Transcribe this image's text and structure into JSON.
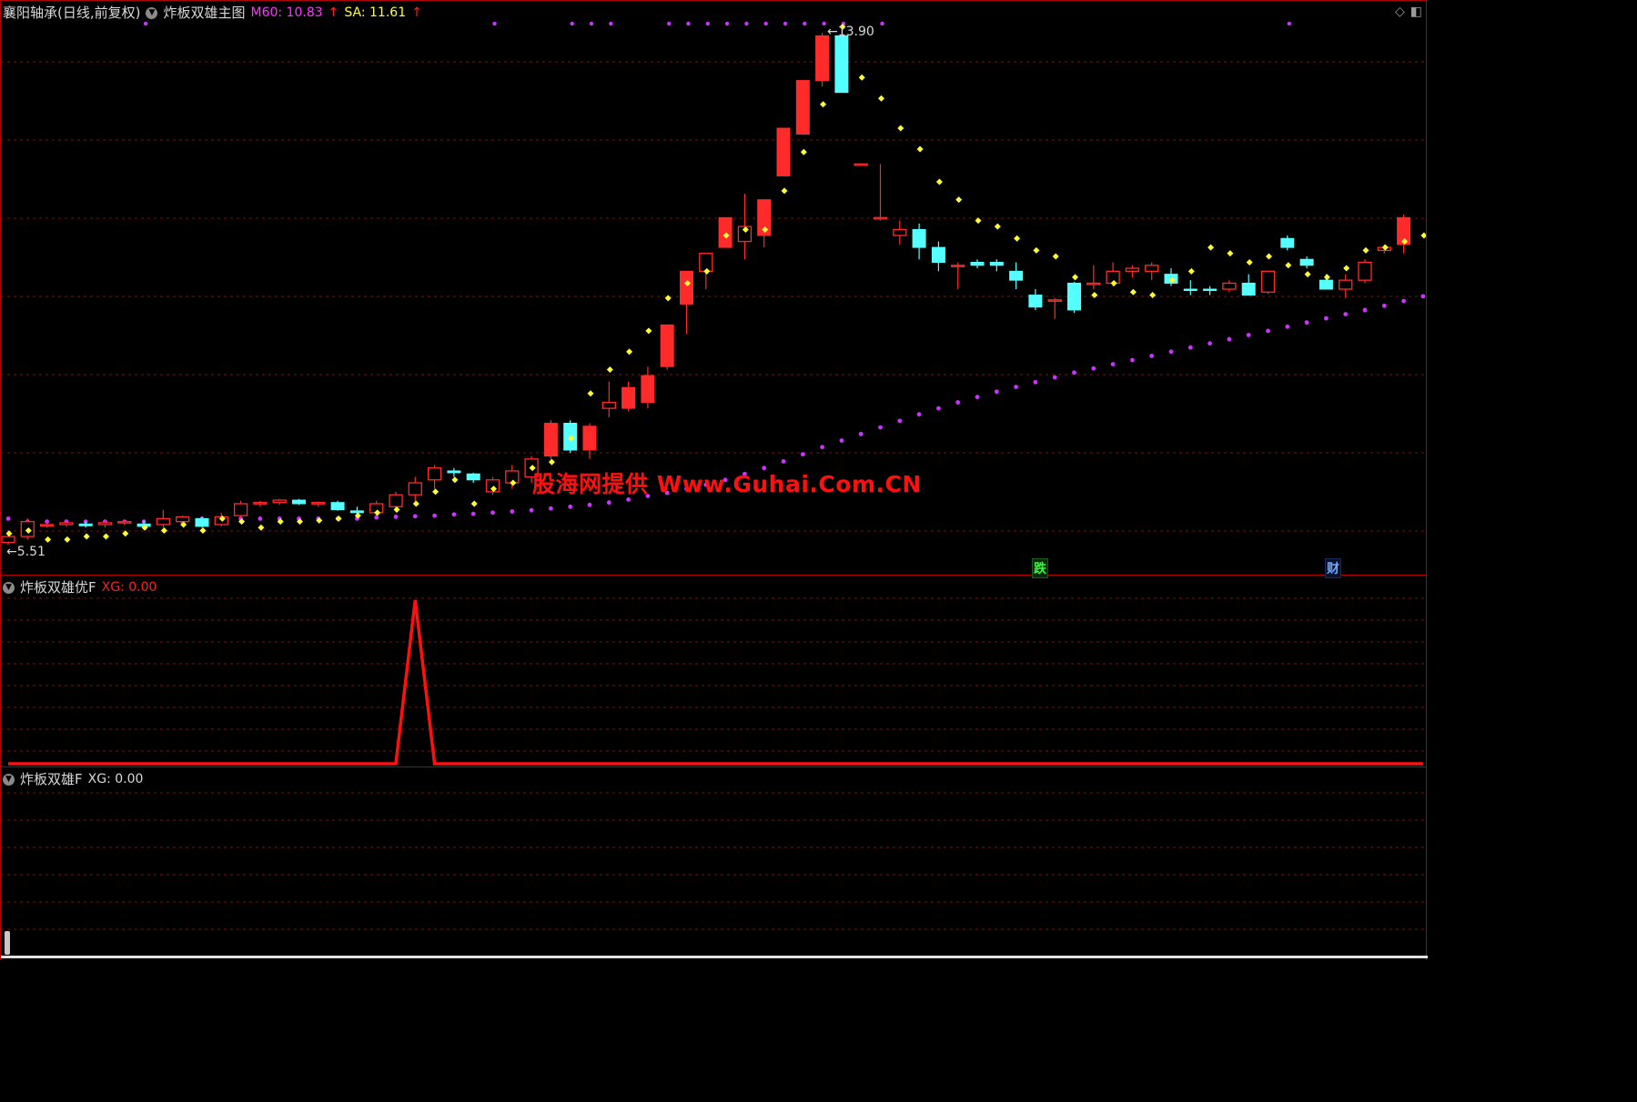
{
  "main": {
    "stock_title": "襄阳轴承(日线,前复权)",
    "formula_title": "炸板双雄主图",
    "m60_label": "M60: 10.83",
    "sa_label": "SA: 11.61",
    "arrow_up": "↑",
    "high_label": "13.90",
    "low_label": "5.51",
    "arrow_left": "←",
    "tag_fall": "跌",
    "tag_fin": "财",
    "watermark": "股海网提供 Www.Guhai.Com.CN"
  },
  "ind1": {
    "title": "炸板双雄优F",
    "value": "XG: 0.00"
  },
  "ind2": {
    "title": "炸板双雄F",
    "value": "XG: 0.00"
  },
  "icons": {
    "dropdown": "chevron-down-icon",
    "diamond": "diamond-icon",
    "window": "window-icon"
  },
  "colors": {
    "up": "#ff2a2a",
    "down": "#55ffff",
    "sa_dot": "#ffff33",
    "m60_dot": "#cc33ff",
    "grid": "#7a1010",
    "signal": "#ff1010"
  },
  "chart_data": [
    {
      "type": "candlestick",
      "price_range": [
        5.3,
        14.3
      ],
      "candles": [
        {
          "o": 5.55,
          "h": 5.75,
          "l": 5.51,
          "c": 5.65
        },
        {
          "o": 5.65,
          "h": 5.95,
          "l": 5.6,
          "c": 5.9
        },
        {
          "o": 5.85,
          "h": 5.9,
          "l": 5.8,
          "c": 5.85
        },
        {
          "o": 5.85,
          "h": 5.9,
          "l": 5.82,
          "c": 5.88
        },
        {
          "o": 5.86,
          "h": 5.9,
          "l": 5.8,
          "c": 5.83
        },
        {
          "o": 5.85,
          "h": 5.92,
          "l": 5.8,
          "c": 5.88
        },
        {
          "o": 5.88,
          "h": 5.93,
          "l": 5.84,
          "c": 5.9
        },
        {
          "o": 5.86,
          "h": 5.92,
          "l": 5.78,
          "c": 5.82
        },
        {
          "o": 5.85,
          "h": 6.1,
          "l": 5.8,
          "c": 5.95
        },
        {
          "o": 5.9,
          "h": 6.0,
          "l": 5.85,
          "c": 5.98
        },
        {
          "o": 5.95,
          "h": 5.98,
          "l": 5.8,
          "c": 5.82
        },
        {
          "o": 5.85,
          "h": 6.05,
          "l": 5.82,
          "c": 5.98
        },
        {
          "o": 6.0,
          "h": 6.25,
          "l": 5.95,
          "c": 6.2
        },
        {
          "o": 6.2,
          "h": 6.25,
          "l": 6.15,
          "c": 6.22
        },
        {
          "o": 6.22,
          "h": 6.28,
          "l": 6.18,
          "c": 6.26
        },
        {
          "o": 6.26,
          "h": 6.28,
          "l": 6.18,
          "c": 6.2
        },
        {
          "o": 6.2,
          "h": 6.24,
          "l": 6.15,
          "c": 6.22
        },
        {
          "o": 6.22,
          "h": 6.25,
          "l": 6.08,
          "c": 6.1
        },
        {
          "o": 6.08,
          "h": 6.15,
          "l": 6.02,
          "c": 6.05
        },
        {
          "o": 6.05,
          "h": 6.25,
          "l": 6.0,
          "c": 6.2
        },
        {
          "o": 6.15,
          "h": 6.4,
          "l": 6.1,
          "c": 6.35
        },
        {
          "o": 6.35,
          "h": 6.65,
          "l": 6.2,
          "c": 6.55
        },
        {
          "o": 6.6,
          "h": 6.85,
          "l": 6.45,
          "c": 6.8
        },
        {
          "o": 6.75,
          "h": 6.8,
          "l": 6.65,
          "c": 6.72
        },
        {
          "o": 6.7,
          "h": 6.72,
          "l": 6.55,
          "c": 6.6
        },
        {
          "o": 6.4,
          "h": 6.65,
          "l": 6.35,
          "c": 6.6
        },
        {
          "o": 6.55,
          "h": 6.85,
          "l": 6.45,
          "c": 6.75
        },
        {
          "o": 6.65,
          "h": 7.0,
          "l": 6.55,
          "c": 6.95
        },
        {
          "o": 7.0,
          "h": 7.6,
          "l": 6.95,
          "c": 7.55
        },
        {
          "o": 7.55,
          "h": 7.6,
          "l": 7.05,
          "c": 7.1
        },
        {
          "o": 7.1,
          "h": 7.55,
          "l": 6.95,
          "c": 7.5
        },
        {
          "o": 7.8,
          "h": 8.25,
          "l": 7.65,
          "c": 7.9
        },
        {
          "o": 7.8,
          "h": 8.25,
          "l": 7.75,
          "c": 8.15
        },
        {
          "o": 7.9,
          "h": 8.5,
          "l": 7.8,
          "c": 8.35
        },
        {
          "o": 8.5,
          "h": 9.2,
          "l": 8.45,
          "c": 9.2
        },
        {
          "o": 9.55,
          "h": 9.7,
          "l": 9.05,
          "c": 10.1
        },
        {
          "o": 10.1,
          "h": 10.15,
          "l": 9.8,
          "c": 10.4
        },
        {
          "o": 10.5,
          "h": 11.0,
          "l": 10.5,
          "c": 11.0
        },
        {
          "o": 10.6,
          "h": 11.4,
          "l": 10.3,
          "c": 10.85
        },
        {
          "o": 10.7,
          "h": 11.3,
          "l": 10.5,
          "c": 11.3
        },
        {
          "o": 11.7,
          "h": 11.7,
          "l": 11.7,
          "c": 12.5
        },
        {
          "o": 12.4,
          "h": 13.3,
          "l": 12.4,
          "c": 13.3
        },
        {
          "o": 13.3,
          "h": 14.1,
          "l": 13.2,
          "c": 14.05
        },
        {
          "o": 14.05,
          "h": 13.95,
          "l": 13.15,
          "c": 13.1
        },
        {
          "o": 11.9,
          "h": 11.9,
          "l": 11.9,
          "c": 11.9
        },
        {
          "o": 11.0,
          "h": 11.9,
          "l": 10.95,
          "c": 11.0
        },
        {
          "o": 10.7,
          "h": 10.95,
          "l": 10.55,
          "c": 10.8
        },
        {
          "o": 10.8,
          "h": 10.9,
          "l": 10.3,
          "c": 10.5
        },
        {
          "o": 10.5,
          "h": 10.6,
          "l": 10.1,
          "c": 10.25
        },
        {
          "o": 10.2,
          "h": 10.25,
          "l": 9.8,
          "c": 10.2
        },
        {
          "o": 10.25,
          "h": 10.3,
          "l": 10.15,
          "c": 10.2
        },
        {
          "o": 10.25,
          "h": 10.3,
          "l": 10.1,
          "c": 10.2
        },
        {
          "o": 10.1,
          "h": 10.25,
          "l": 9.8,
          "c": 9.95
        },
        {
          "o": 9.7,
          "h": 9.8,
          "l": 9.45,
          "c": 9.5
        },
        {
          "o": 9.6,
          "h": 9.65,
          "l": 9.3,
          "c": 9.62
        },
        {
          "o": 9.9,
          "h": 9.92,
          "l": 9.4,
          "c": 9.45
        },
        {
          "o": 9.9,
          "h": 10.2,
          "l": 9.8,
          "c": 9.9
        },
        {
          "o": 9.9,
          "h": 10.25,
          "l": 9.85,
          "c": 10.1
        },
        {
          "o": 10.1,
          "h": 10.2,
          "l": 10.0,
          "c": 10.15
        },
        {
          "o": 10.1,
          "h": 10.25,
          "l": 9.95,
          "c": 10.2
        },
        {
          "o": 10.05,
          "h": 10.15,
          "l": 9.85,
          "c": 9.9
        },
        {
          "o": 9.8,
          "h": 9.95,
          "l": 9.7,
          "c": 9.78
        },
        {
          "o": 9.8,
          "h": 9.85,
          "l": 9.7,
          "c": 9.78
        },
        {
          "o": 9.8,
          "h": 9.95,
          "l": 9.75,
          "c": 9.9
        },
        {
          "o": 9.9,
          "h": 10.05,
          "l": 9.7,
          "c": 9.7
        },
        {
          "o": 9.75,
          "h": 10.1,
          "l": 9.72,
          "c": 10.1
        },
        {
          "o": 10.65,
          "h": 10.7,
          "l": 10.45,
          "c": 10.5
        },
        {
          "o": 10.3,
          "h": 10.35,
          "l": 10.15,
          "c": 10.2
        },
        {
          "o": 9.95,
          "h": 10.05,
          "l": 9.8,
          "c": 9.8
        },
        {
          "o": 9.8,
          "h": 10.05,
          "l": 9.65,
          "c": 9.95
        },
        {
          "o": 9.95,
          "h": 10.3,
          "l": 9.9,
          "c": 10.25
        },
        {
          "o": 10.45,
          "h": 10.55,
          "l": 10.4,
          "c": 10.5
        },
        {
          "o": 10.55,
          "h": 11.05,
          "l": 10.4,
          "c": 11.0
        }
      ],
      "sa_dots": [
        5.7,
        5.75,
        5.6,
        5.6,
        5.65,
        5.65,
        5.7,
        5.8,
        5.75,
        5.85,
        5.75,
        5.95,
        5.9,
        5.8,
        5.9,
        5.9,
        5.92,
        5.95,
        6.0,
        6.05,
        6.1,
        6.2,
        6.4,
        6.6,
        6.2,
        6.45,
        6.55,
        6.8,
        6.9,
        7.3,
        8.05,
        8.45,
        8.75,
        9.1,
        9.65,
        9.9,
        10.1,
        10.7,
        10.8,
        10.8,
        11.45,
        12.1,
        12.9,
        14.2,
        13.35,
        13.0,
        12.5,
        12.15,
        11.6,
        11.3,
        10.95,
        10.85,
        10.65,
        10.45,
        10.35,
        10.0,
        9.7,
        9.9,
        9.75,
        9.7,
        9.95,
        10.1,
        10.5,
        10.4,
        10.25,
        10.35,
        10.2,
        10.05,
        10.0,
        10.15,
        10.45,
        10.5,
        10.6,
        10.7
      ],
      "m60_dots": [
        5.95,
        5.9,
        5.9,
        5.9,
        5.9,
        5.9,
        5.9,
        5.9,
        5.9,
        5.9,
        5.95,
        5.95,
        5.95,
        5.95,
        5.95,
        5.95,
        5.95,
        5.95,
        5.95,
        5.97,
        5.98,
        5.99,
        6.0,
        6.02,
        6.03,
        6.05,
        6.07,
        6.09,
        6.12,
        6.15,
        6.18,
        6.22,
        6.27,
        6.33,
        6.38,
        6.45,
        6.52,
        6.6,
        6.7,
        6.8,
        6.91,
        7.03,
        7.15,
        7.26,
        7.37,
        7.48,
        7.59,
        7.7,
        7.8,
        7.9,
        7.99,
        8.08,
        8.16,
        8.24,
        8.32,
        8.4,
        8.47,
        8.54,
        8.61,
        8.68,
        8.75,
        8.82,
        8.89,
        8.96,
        9.03,
        9.1,
        9.17,
        9.24,
        9.31,
        9.38,
        9.45,
        9.52,
        9.6,
        9.68,
        9.76
      ],
      "top_m60_dot_indices": [
        7,
        25,
        29,
        30,
        31,
        34,
        35,
        36,
        37,
        38,
        39,
        40,
        41,
        42,
        43,
        45,
        66
      ]
    },
    {
      "type": "line",
      "name": "炸板双雄优F",
      "values_note_index_of_spike": 21,
      "values": [
        0,
        0,
        0,
        0,
        0,
        0,
        0,
        0,
        0,
        0,
        0,
        0,
        0,
        0,
        0,
        0,
        0,
        0,
        0,
        0,
        0,
        1,
        0,
        0,
        0,
        0,
        0,
        0,
        0,
        0,
        0,
        0,
        0,
        0,
        0,
        0,
        0,
        0,
        0,
        0,
        0,
        0,
        0,
        0,
        0,
        0,
        0,
        0,
        0,
        0,
        0,
        0,
        0,
        0,
        0,
        0,
        0,
        0,
        0,
        0,
        0,
        0,
        0,
        0,
        0,
        0,
        0,
        0,
        0,
        0,
        0,
        0,
        0,
        0
      ]
    },
    {
      "type": "line",
      "name": "炸板双雄F",
      "values": []
    }
  ]
}
